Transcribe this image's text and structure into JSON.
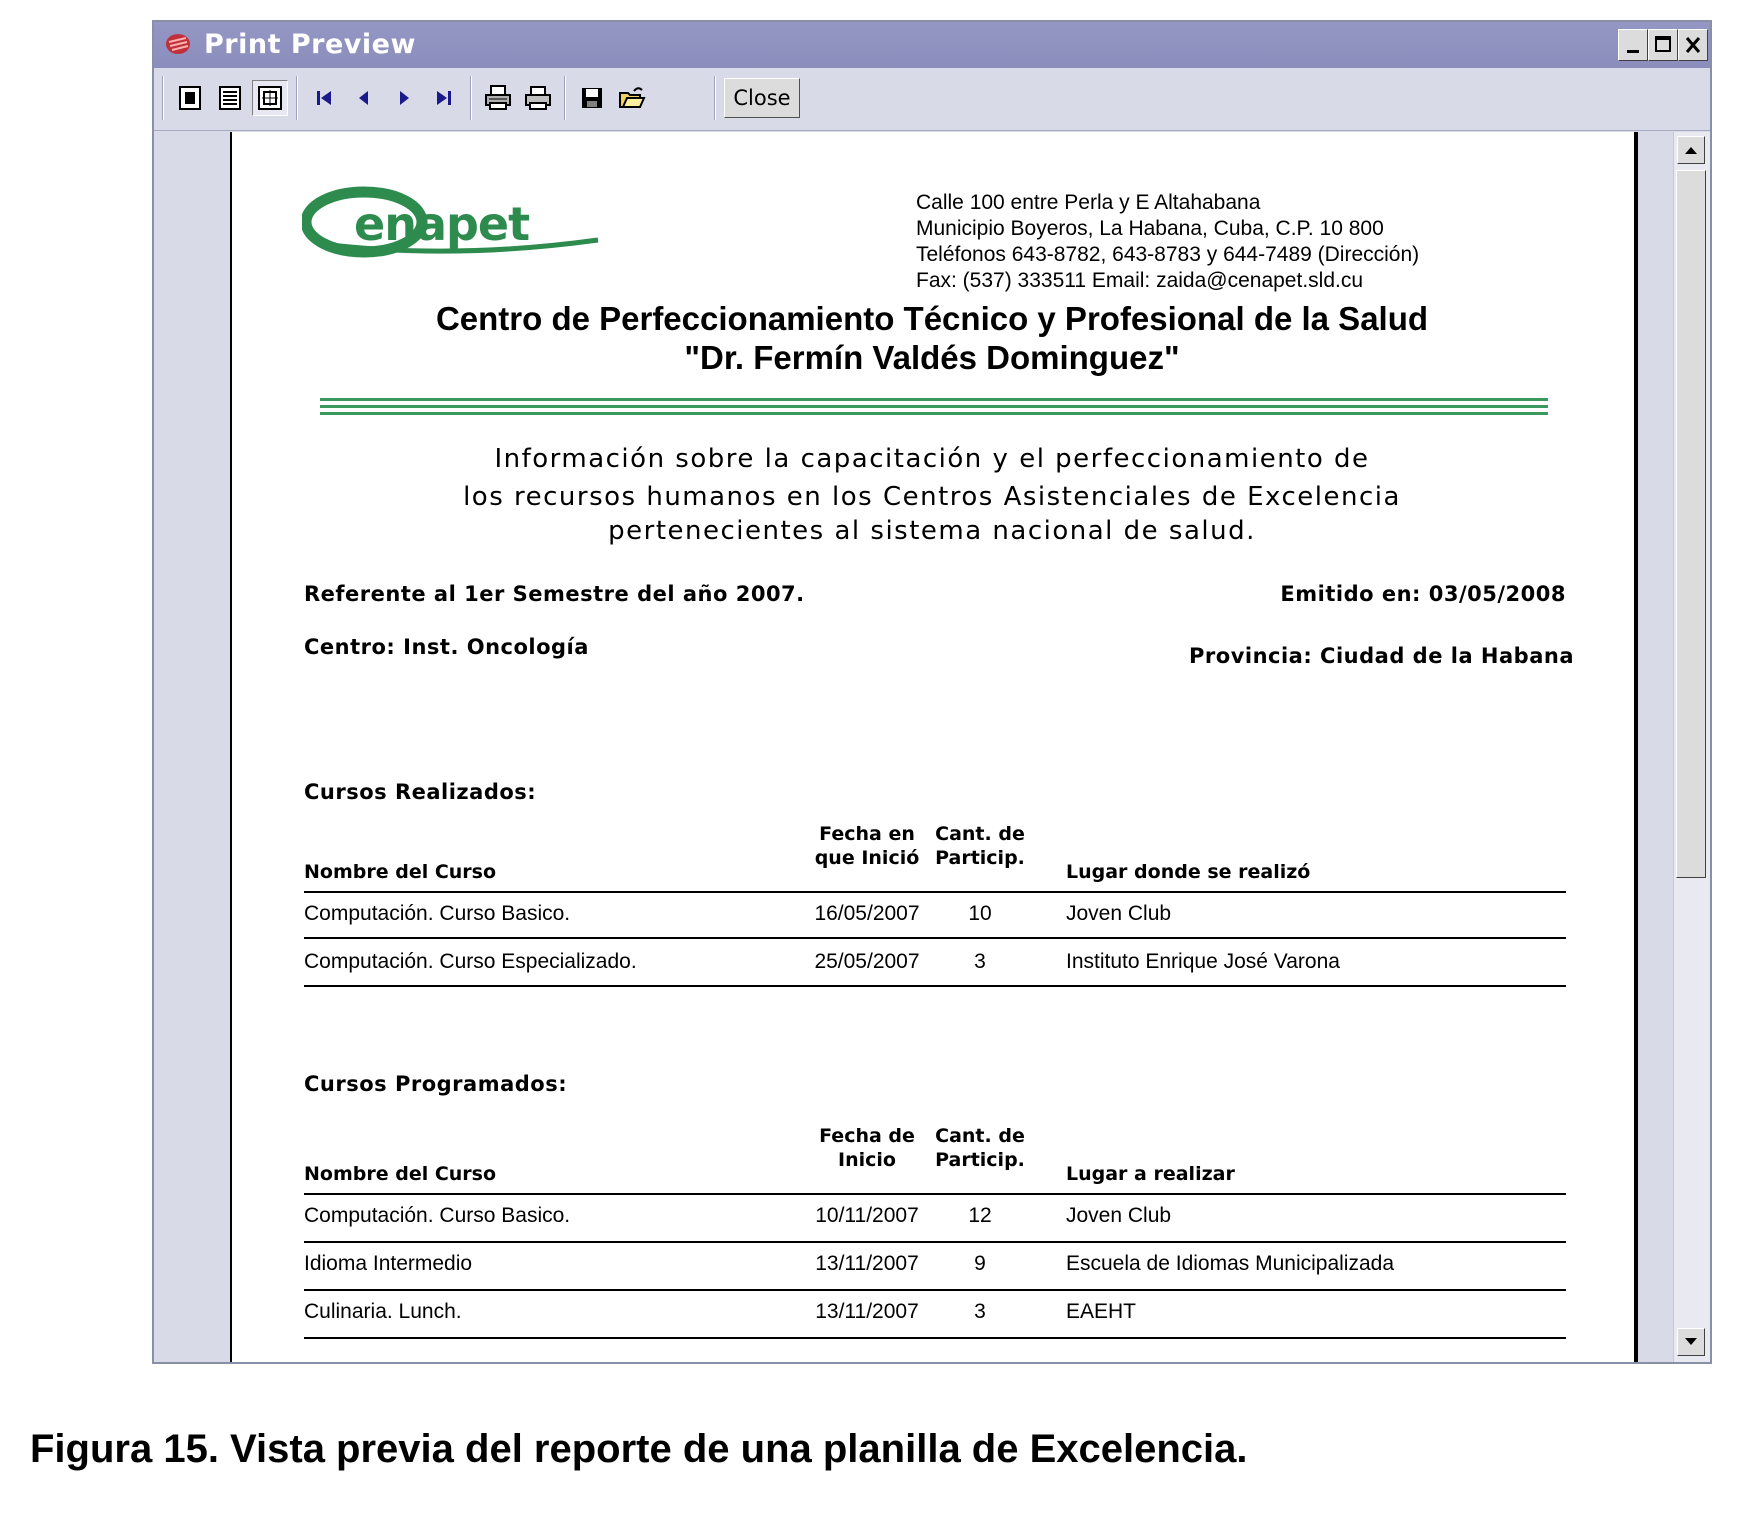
{
  "window": {
    "title": "Print Preview",
    "close_label": "Close",
    "toolbar_icons": [
      "one-page-view-icon",
      "multi-page-view-icon",
      "fit-page-icon",
      "first-page-icon",
      "previous-page-icon",
      "next-page-icon",
      "last-page-icon",
      "print-setup-icon",
      "print-icon",
      "save-icon",
      "open-icon"
    ]
  },
  "report": {
    "logo_text": "Cenapet",
    "address": [
      "Calle 100 entre Perla y E Altahabana",
      "Municipio Boyeros, La Habana, Cuba, C.P. 10 800",
      "Teléfonos 643-8782, 643-8783 y 644-7489 (Dirección)",
      "Fax: (537) 333511 Email: zaida@cenapet.sld.cu"
    ],
    "institution_line1": "Centro de Perfeccionamiento Técnico y Profesional de la Salud",
    "institution_line2": "\"Dr. Fermín Valdés Dominguez\"",
    "subtitle": [
      "Información sobre la capacitación y el perfeccionamiento de",
      "los recursos humanos en los Centros Asistenciales de Excelencia",
      "pertenecientes al sistema nacional de salud."
    ],
    "referente": "Referente al 1er Semestre del año 2007.",
    "emitido": "Emitido en: 03/05/2008",
    "centro": "Centro: Inst. Oncología",
    "provincia": "Provincia: Ciudad de la Habana",
    "realizados": {
      "heading": "Cursos Realizados:",
      "headers": {
        "nombre": "Nombre del Curso",
        "fecha1": "Fecha en",
        "fecha2": "que Inició",
        "cant1": "Cant. de",
        "cant2": "Particip.",
        "lugar": "Lugar donde se realizó"
      },
      "rows": [
        {
          "nombre": "Computación. Curso Basico.",
          "fecha": "16/05/2007",
          "cant": "10",
          "lugar": "Joven Club"
        },
        {
          "nombre": "Computación. Curso Especializado.",
          "fecha": "25/05/2007",
          "cant": "3",
          "lugar": "Instituto Enrique José Varona"
        }
      ]
    },
    "programados": {
      "heading": "Cursos Programados:",
      "headers": {
        "nombre": "Nombre del Curso",
        "fecha1": "Fecha de",
        "fecha2": "Inicio",
        "cant1": "Cant. de",
        "cant2": "Particip.",
        "lugar": "Lugar a realizar"
      },
      "rows": [
        {
          "nombre": "Computación. Curso Basico.",
          "fecha": "10/11/2007",
          "cant": "12",
          "lugar": "Joven Club"
        },
        {
          "nombre": "Idioma Intermedio",
          "fecha": "13/11/2007",
          "cant": "9",
          "lugar": "Escuela de Idiomas Municipalizada"
        },
        {
          "nombre": "Culinaria. Lunch.",
          "fecha": "13/11/2007",
          "cant": "3",
          "lugar": "EAEHT"
        }
      ]
    }
  },
  "caption": "Figura 15. Vista previa del reporte de una planilla de Excelencia."
}
